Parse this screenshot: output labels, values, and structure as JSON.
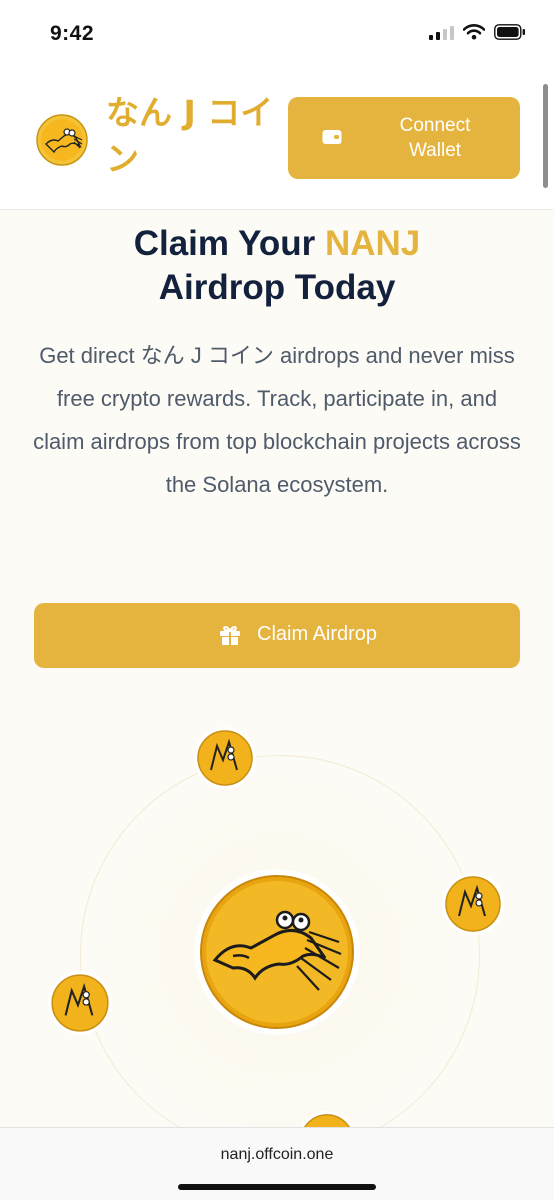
{
  "status_bar": {
    "time": "9:42",
    "battery_icon": "battery-icon",
    "wifi_icon": "wifi-icon",
    "signal_icon": "signal-icon"
  },
  "header": {
    "brand_name": "なん J コイン",
    "logo_icon": "nanj-coin-logo",
    "connect_button": {
      "label": "Connect Wallet",
      "icon": "wallet-icon"
    }
  },
  "hero": {
    "title_prefix": "Claim Your ",
    "title_accent": "NANJ",
    "title_suffix": "Airdrop Today",
    "description": "Get direct なん J コイン airdrops and never miss free crypto rewards. Track, participate in, and claim airdrops from top blockchain projects across the Solana ecosystem.",
    "claim_button": {
      "label": "Claim Airdrop",
      "icon": "gift-icon"
    }
  },
  "browser": {
    "url": "nanj.offcoin.one"
  },
  "colors": {
    "accent": "#e5b43f",
    "brand_text": "#e0ad2e",
    "heading": "#14213d",
    "body_text": "#4f5b6b",
    "background": "#fdfbf6"
  }
}
